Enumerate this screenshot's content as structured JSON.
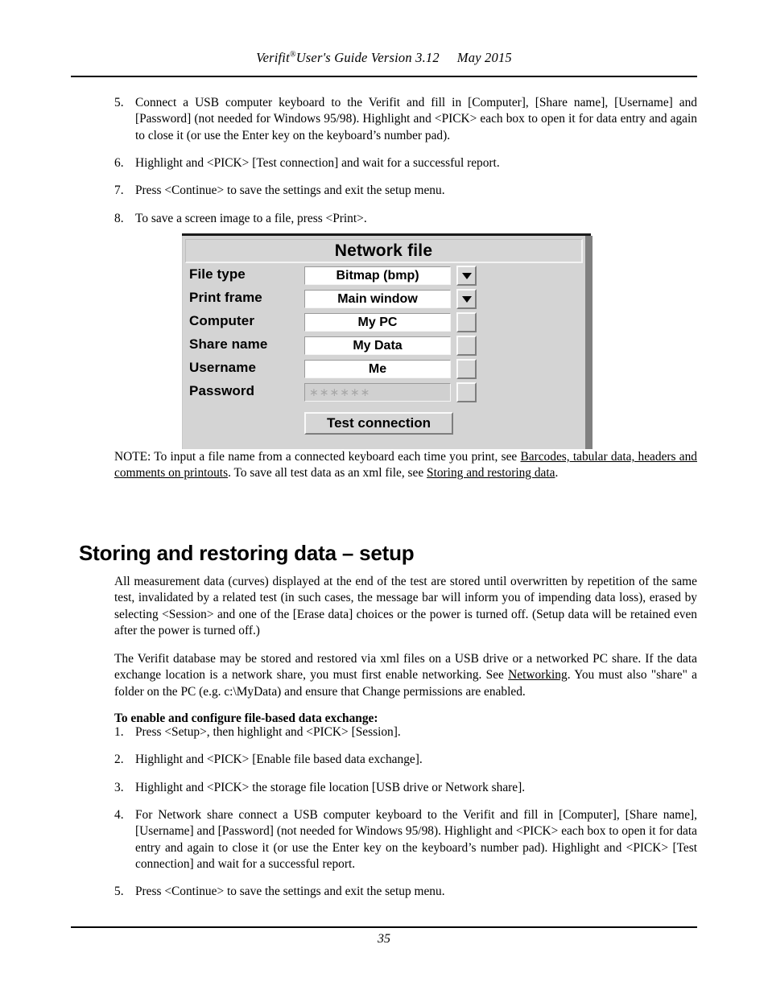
{
  "header": {
    "title_prefix": "Verifit",
    "registered_mark": "®",
    "title_main": "User's Guide Version 3.12",
    "date": "May 2015"
  },
  "top_list": [
    {
      "marker": "5.",
      "text": "Connect a USB computer keyboard to the Verifit and fill in [Computer], [Share name], [Username] and [Password] (not needed for Windows 95/98). Highlight and <PICK> each box to open it for data entry and again to close it (or use the Enter key on the keyboard’s number pad)."
    },
    {
      "marker": "6.",
      "text": "Highlight and <PICK> [Test connection] and wait for a successful report."
    },
    {
      "marker": "7.",
      "text": "Press <Continue> to save the settings and exit the setup menu."
    },
    {
      "marker": "8.",
      "text": "To save a screen image to a file, press <Print>."
    }
  ],
  "dialog": {
    "title": "Network file",
    "rows": [
      {
        "label": "File type",
        "value": "Bitmap (bmp)",
        "control": "dropdown"
      },
      {
        "label": "Print frame",
        "value": "Main window",
        "control": "dropdown"
      },
      {
        "label": "Computer",
        "value": "My PC",
        "control": "button"
      },
      {
        "label": "Share name",
        "value": "My Data",
        "control": "button"
      },
      {
        "label": "Username",
        "value": "Me",
        "control": "button"
      },
      {
        "label": "Password",
        "value": "∗∗∗∗∗∗",
        "control": "button",
        "disabled": true
      }
    ],
    "test_button": "Test connection",
    "colors": {
      "face": "#d4d4d4",
      "field": "#ffffff",
      "disabled_field": "#d0d0d0",
      "shadow": "#808080"
    }
  },
  "note": {
    "prefix": "NOTE: To input a file name from a connected keyboard each time you print, see ",
    "link1": "Barcodes, tabular data, headers and comments on printouts",
    "middle": ". To save all test data as an xml file, see ",
    "link2": "Storing and restoring data",
    "suffix": "."
  },
  "section": {
    "title": "Storing and restoring data – setup",
    "para1": "All measurement data (curves) displayed at the end of the test are stored until overwritten by repetition of the same test, invalidated by a related test (in such cases, the message bar will inform you of impending data loss), erased by selecting <Session> and one of the [Erase data] choices or the power is turned off. (Setup data will be retained even after the power is turned off.)",
    "para2_before": "The Verifit database may be stored and restored via xml files on a USB drive or a networked PC share. If the data exchange location is a network share, you must first enable networking. See ",
    "para2_link": "Networking",
    "para2_after": ". You must also \"share\" a folder on the PC (e.g. c:\\MyData) and ensure that Change permissions are enabled.",
    "subhead": "To enable and configure file-based data exchange:"
  },
  "bottom_list": [
    {
      "marker": "1.",
      "text": "Press <Setup>, then highlight and <PICK> [Session]."
    },
    {
      "marker": "2.",
      "text": "Highlight and <PICK> [Enable file based data exchange]."
    },
    {
      "marker": "3.",
      "text": "Highlight and <PICK> the storage file location [USB drive or Network share]."
    },
    {
      "marker": "4.",
      "text": "For Network share connect a USB computer keyboard to the Verifit and fill in [Computer], [Share name], [Username] and [Password] (not needed for Windows 95/98). Highlight and <PICK> each box to open it for data entry and again to close it (or use the Enter key on the keyboard’s number pad). Highlight and <PICK> [Test connection] and wait for a successful report."
    },
    {
      "marker": "5.",
      "text": "Press <Continue> to save the settings and exit the setup menu."
    }
  ],
  "footer": {
    "page_number": "35"
  }
}
